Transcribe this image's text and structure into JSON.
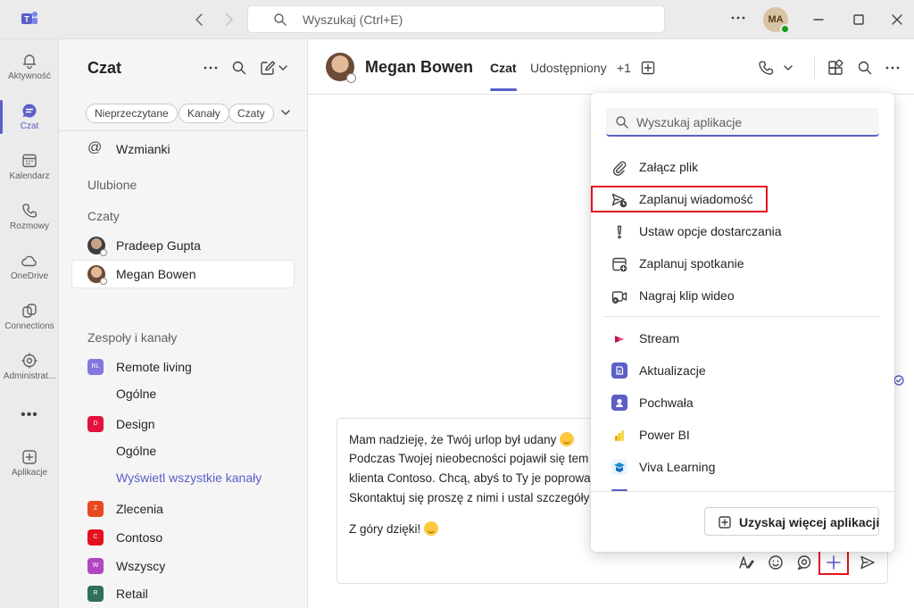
{
  "titlebar": {
    "search_placeholder": "Wyszukaj (Ctrl+E)",
    "user_initials": "MA"
  },
  "rail": [
    {
      "label": "Aktywność",
      "icon": "bell-icon"
    },
    {
      "label": "Czat",
      "icon": "chat-icon",
      "active": true
    },
    {
      "label": "Kalendarz",
      "icon": "calendar-icon"
    },
    {
      "label": "Rozmowy",
      "icon": "phone-icon"
    },
    {
      "label": "OneDrive",
      "icon": "cloud-icon"
    },
    {
      "label": "Connections",
      "icon": "connections-icon"
    },
    {
      "label": "Administrat...",
      "icon": "admin-icon"
    },
    {
      "label": "Aplikacje",
      "icon": "add-apps-icon"
    }
  ],
  "chatpane": {
    "title": "Czat",
    "filters": [
      "Nieprzeczytane",
      "Kanały",
      "Czaty"
    ],
    "mentions": "Wzmianki",
    "favorites": "Ulubione",
    "chats_heading": "Czaty",
    "chats": [
      "Pradeep Gupta",
      "Megan Bowen"
    ],
    "teams_heading": "Zespoły i kanały",
    "teams": [
      {
        "name": "Remote living",
        "color": "#8378de"
      },
      {
        "channel": "Ogólne"
      },
      {
        "name": "Design",
        "color": "#e3123c"
      },
      {
        "channel": "Ogólne"
      },
      {
        "link": "Wyświetl wszystkie kanały"
      },
      {
        "name": "Zlecenia",
        "color": "#e8491d"
      },
      {
        "name": "Contoso",
        "color": "#e3121e"
      },
      {
        "name": "Wszyscy",
        "color": "#b146c2"
      },
      {
        "name": "Retail",
        "color": "#2f6f5e"
      }
    ]
  },
  "main": {
    "contact_name": "Megan Bowen",
    "tabs": [
      "Czat",
      "Udostępniony",
      "+1"
    ],
    "message_lines": [
      "Mam nadzieję, że Twój urlop był udany",
      "Podczas Twojej nieobecności pojawił się tem",
      "klienta Contoso. Chcą, abyś to Ty je poprowa",
      "Skontaktuj się proszę z nimi i ustal szczegóły",
      "",
      "Z góry dzięki!"
    ]
  },
  "popup": {
    "search_placeholder": "Wyszukaj aplikacje",
    "actions": [
      {
        "label": "Załącz plik",
        "icon": "paperclip-icon"
      },
      {
        "label": "Zaplanuj wiadomość",
        "icon": "schedule-send-icon",
        "highlighted": true
      },
      {
        "label": "Ustaw opcje dostarczania",
        "icon": "exclamation-icon"
      },
      {
        "label": "Zaplanuj spotkanie",
        "icon": "calendar-add-icon"
      },
      {
        "label": "Nagraj klip wideo",
        "icon": "video-clip-icon"
      }
    ],
    "apps": [
      {
        "label": "Stream",
        "color": "#bc1948"
      },
      {
        "label": "Aktualizacje",
        "color": "#5b5fc7"
      },
      {
        "label": "Pochwała",
        "color": "#5b5fc7"
      },
      {
        "label": "Power BI",
        "color": "#f2c811"
      },
      {
        "label": "Viva Learning",
        "color": "#1e8bcd"
      }
    ],
    "more_button": "Uzyskaj więcej aplikacji"
  },
  "colors": {
    "accent": "#5b5fc7",
    "highlight": "#e3121e"
  }
}
